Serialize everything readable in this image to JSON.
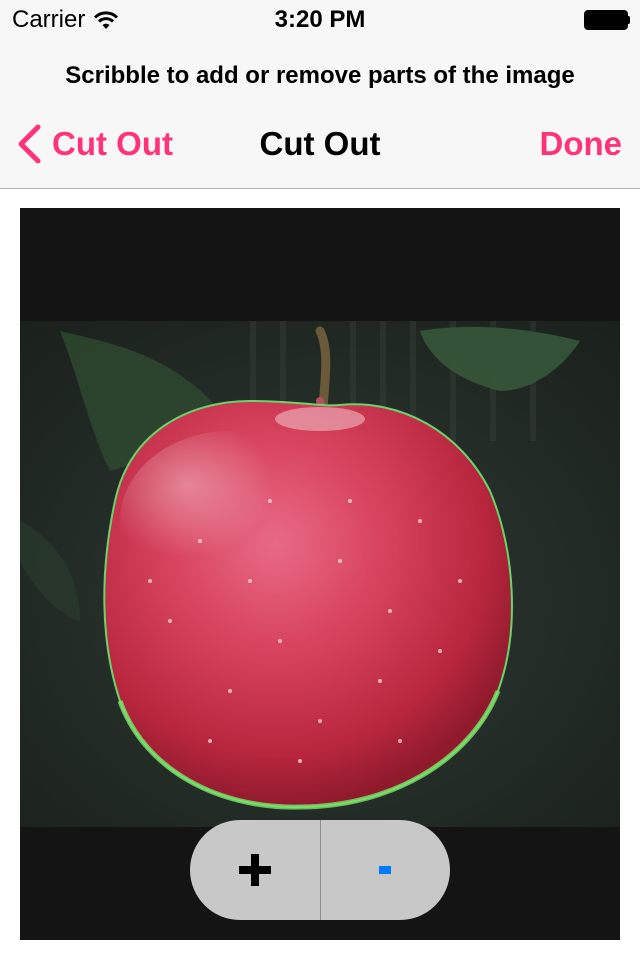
{
  "status_bar": {
    "carrier": "Carrier",
    "time": "3:20 PM",
    "wifi_icon": "wifi-icon",
    "battery_icon": "battery-icon"
  },
  "nav": {
    "prompt": "Scribble to add or remove parts of the image",
    "back_label": "Cut Out",
    "title": "Cut Out",
    "done_label": "Done",
    "accent_color": "#ff3377"
  },
  "editor": {
    "image_icon": "apple-photo",
    "add_icon": "plus-icon",
    "remove_icon": "minus-icon"
  }
}
